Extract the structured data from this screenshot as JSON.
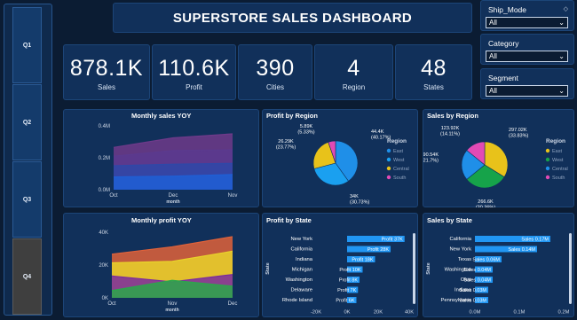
{
  "title": "SUPERSTORE SALES DASHBOARD",
  "quarters": [
    {
      "label": "Q1",
      "selected": false
    },
    {
      "label": "Q2",
      "selected": false
    },
    {
      "label": "Q3",
      "selected": false
    },
    {
      "label": "Q4",
      "selected": true
    }
  ],
  "kpis": [
    {
      "value": "878.1K",
      "label": "Sales"
    },
    {
      "value": "110.6K",
      "label": "Profit"
    },
    {
      "value": "390",
      "label": "Cities"
    },
    {
      "value": "4",
      "label": "Region"
    },
    {
      "value": "48",
      "label": "States"
    }
  ],
  "slicers": [
    {
      "label": "Ship_Mode",
      "value": "All"
    },
    {
      "label": "Category",
      "value": "All"
    },
    {
      "label": "Segment",
      "value": "All"
    }
  ],
  "icons": {
    "quarter": "quarter-button-icon",
    "erase": "eraser-icon",
    "dropdown": "chevron-down-icon"
  },
  "colors": {
    "background": "#0b1c33",
    "panel": "#11305a",
    "bar": "#2196f3",
    "text": "#ffffff"
  },
  "chart_data": [
    {
      "type": "area",
      "title": "Monthly sales YOY",
      "xlabel": "month",
      "ylabel": "",
      "categories": [
        "Oct",
        "Dec",
        "Nov"
      ],
      "ylim": [
        0,
        400000
      ],
      "yticks": [
        "0.0M",
        "0.2M",
        "0.4M"
      ],
      "series": [
        {
          "values": [
            80000,
            85000,
            95000
          ],
          "color": "#1f5fd6"
        },
        {
          "values": [
            150000,
            160000,
            165000
          ],
          "color": "#2f48a8"
        },
        {
          "values": [
            210000,
            245000,
            250000
          ],
          "color": "#5b3a8f"
        },
        {
          "values": [
            265000,
            325000,
            350000
          ],
          "color": "#6e3a8a"
        }
      ]
    },
    {
      "type": "pie",
      "title": "Profit by Region",
      "legend_title": "Region",
      "slices": [
        {
          "name": "East",
          "value": 44400,
          "label": "44.4K",
          "pct": "(40.17%)",
          "color": "#1f8fe8"
        },
        {
          "name": "West",
          "value": 34000,
          "label": "34K",
          "pct": "(30.73%)",
          "color": "#1aa0f0"
        },
        {
          "name": "Central",
          "value": 26290,
          "label": "26.29K",
          "pct": "(23.77%)",
          "color": "#e8c21a"
        },
        {
          "name": "South",
          "value": 5890,
          "label": "5.89K",
          "pct": "(5.33%)",
          "color": "#e24ab5"
        }
      ]
    },
    {
      "type": "pie",
      "title": "Sales by Region",
      "legend_title": "Region",
      "slices": [
        {
          "name": "East",
          "value": 297020,
          "label": "297.02K",
          "pct": "(33.83%)",
          "color": "#e8c21a"
        },
        {
          "name": "West",
          "value": 266600,
          "label": "266.6K",
          "pct": "(30.36%)",
          "color": "#16a34a"
        },
        {
          "name": "Central",
          "value": 190540,
          "label": "190.54K",
          "pct": "(21.7%)",
          "color": "#1f8fe8"
        },
        {
          "name": "South",
          "value": 123920,
          "label": "123.92K",
          "pct": "(14.11%)",
          "color": "#e24ab5"
        }
      ],
      "legend_colors": [
        "#e8c21a",
        "#16a34a",
        "#1f8fe8",
        "#e24ab5"
      ]
    },
    {
      "type": "area",
      "title": "Monthly profit YOY",
      "xlabel": "month",
      "ylabel": "",
      "categories": [
        "Oct",
        "Nov",
        "Dec"
      ],
      "ylim": [
        0,
        45000
      ],
      "yticks": [
        "0K",
        "20K",
        "40K"
      ],
      "series": [
        {
          "values": [
            5000,
            12000,
            8000
          ],
          "color": "#2aa84a"
        },
        {
          "values": [
            15000,
            11000,
            16000
          ],
          "color": "#7a2aa0"
        },
        {
          "values": [
            24000,
            25000,
            32000
          ],
          "color": "#e8d22a"
        },
        {
          "values": [
            30000,
            35000,
            42000
          ],
          "color": "#e0623a"
        }
      ]
    },
    {
      "type": "bar",
      "title": "Profit by State",
      "ylabel": "State",
      "xticks": [
        "-20K",
        "0K",
        "20K",
        "40K"
      ],
      "xlim": [
        -20000,
        40000
      ],
      "categories": [
        "New York",
        "California",
        "Indiana",
        "Michigan",
        "Washington",
        "Delaware",
        "Rhode Island"
      ],
      "values": [
        37000,
        28000,
        18000,
        10000,
        8000,
        7000,
        6000
      ],
      "data_labels": [
        "Profit 37K",
        "Profit 28K",
        "Profit 18K",
        "Profit 10K",
        "Profit 8K",
        "Profit 7K",
        "Profit 6K"
      ]
    },
    {
      "type": "bar",
      "title": "Sales by State",
      "ylabel": "State",
      "xticks": [
        "0.0M",
        "0.1M",
        "0.2M"
      ],
      "xlim": [
        0,
        0.2
      ],
      "categories": [
        "California",
        "New York",
        "Texas",
        "Washington",
        "Ohio",
        "Indiana",
        "Pennsylvania"
      ],
      "values": [
        0.17,
        0.14,
        0.06,
        0.04,
        0.04,
        0.03,
        0.03
      ],
      "data_labels": [
        "Sales 0.17M",
        "Sales 0.14M",
        "Sales 0.06M",
        "Sales 0.04M",
        "Sales 0.04M",
        "Sales 0.03M",
        "Sales 0.03M"
      ]
    }
  ]
}
